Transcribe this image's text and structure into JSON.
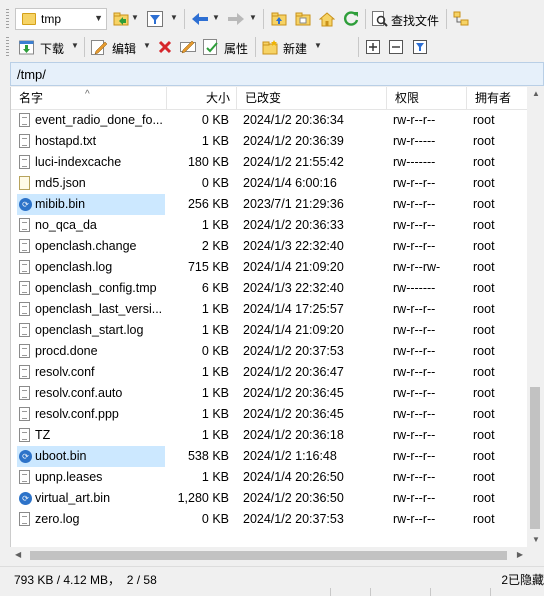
{
  "toolbar1": {
    "path_combo_value": "tmp",
    "find_files_label": "查找文件"
  },
  "toolbar2": {
    "download_label": "下载",
    "edit_label": "编辑",
    "properties_label": "属性",
    "new_label": "新建"
  },
  "path": "/tmp/",
  "columns": {
    "name": "名字",
    "size": "大小",
    "modified": "已改变",
    "permissions": "权限",
    "owner": "拥有者"
  },
  "files": [
    {
      "name": "event_radio_done_fo...",
      "size": "0 KB",
      "modified": "2024/1/2 20:36:34",
      "perm": "rw-r--r--",
      "owner": "root",
      "icon": "doc",
      "selected": false
    },
    {
      "name": "hostapd.txt",
      "size": "1 KB",
      "modified": "2024/1/2 20:36:39",
      "perm": "rw-r-----",
      "owner": "root",
      "icon": "doc",
      "selected": false
    },
    {
      "name": "luci-indexcache",
      "size": "180 KB",
      "modified": "2024/1/2 21:55:42",
      "perm": "rw-------",
      "owner": "root",
      "icon": "doc",
      "selected": false
    },
    {
      "name": "md5.json",
      "size": "0 KB",
      "modified": "2024/1/4 6:00:16",
      "perm": "rw-r--r--",
      "owner": "root",
      "icon": "json",
      "selected": false
    },
    {
      "name": "mibib.bin",
      "size": "256 KB",
      "modified": "2023/7/1 21:29:36",
      "perm": "rw-r--r--",
      "owner": "root",
      "icon": "bin",
      "selected": true
    },
    {
      "name": "no_qca_da",
      "size": "1 KB",
      "modified": "2024/1/2 20:36:33",
      "perm": "rw-r--r--",
      "owner": "root",
      "icon": "doc",
      "selected": false
    },
    {
      "name": "openclash.change",
      "size": "2 KB",
      "modified": "2024/1/3 22:32:40",
      "perm": "rw-r--r--",
      "owner": "root",
      "icon": "doc",
      "selected": false
    },
    {
      "name": "openclash.log",
      "size": "715 KB",
      "modified": "2024/1/4 21:09:20",
      "perm": "rw-r--rw-",
      "owner": "root",
      "icon": "doc",
      "selected": false
    },
    {
      "name": "openclash_config.tmp",
      "size": "6 KB",
      "modified": "2024/1/3 22:32:40",
      "perm": "rw-------",
      "owner": "root",
      "icon": "doc",
      "selected": false
    },
    {
      "name": "openclash_last_versi...",
      "size": "1 KB",
      "modified": "2024/1/4 17:25:57",
      "perm": "rw-r--r--",
      "owner": "root",
      "icon": "doc",
      "selected": false
    },
    {
      "name": "openclash_start.log",
      "size": "1 KB",
      "modified": "2024/1/4 21:09:20",
      "perm": "rw-r--r--",
      "owner": "root",
      "icon": "doc",
      "selected": false
    },
    {
      "name": "procd.done",
      "size": "0 KB",
      "modified": "2024/1/2 20:37:53",
      "perm": "rw-r--r--",
      "owner": "root",
      "icon": "doc",
      "selected": false
    },
    {
      "name": "resolv.conf",
      "size": "1 KB",
      "modified": "2024/1/2 20:36:47",
      "perm": "rw-r--r--",
      "owner": "root",
      "icon": "doc",
      "selected": false
    },
    {
      "name": "resolv.conf.auto",
      "size": "1 KB",
      "modified": "2024/1/2 20:36:45",
      "perm": "rw-r--r--",
      "owner": "root",
      "icon": "doc",
      "selected": false
    },
    {
      "name": "resolv.conf.ppp",
      "size": "1 KB",
      "modified": "2024/1/2 20:36:45",
      "perm": "rw-r--r--",
      "owner": "root",
      "icon": "doc",
      "selected": false
    },
    {
      "name": "TZ",
      "size": "1 KB",
      "modified": "2024/1/2 20:36:18",
      "perm": "rw-r--r--",
      "owner": "root",
      "icon": "doc",
      "selected": false
    },
    {
      "name": "uboot.bin",
      "size": "538 KB",
      "modified": "2024/1/2 1:16:48",
      "perm": "rw-r--r--",
      "owner": "root",
      "icon": "bin",
      "selected": true
    },
    {
      "name": "upnp.leases",
      "size": "1 KB",
      "modified": "2024/1/4 20:26:50",
      "perm": "rw-r--r--",
      "owner": "root",
      "icon": "doc",
      "selected": false
    },
    {
      "name": "virtual_art.bin",
      "size": "1,280 KB",
      "modified": "2024/1/2 20:36:50",
      "perm": "rw-r--r--",
      "owner": "root",
      "icon": "bin",
      "selected": false
    },
    {
      "name": "zero.log",
      "size": "0 KB",
      "modified": "2024/1/2 20:37:53",
      "perm": "rw-r--r--",
      "owner": "root",
      "icon": "doc",
      "selected": false
    }
  ],
  "status": {
    "left": "793 KB / 4.12 MB，  2 / 58",
    "right": "2已隐藏"
  },
  "colors": {
    "selection": "#cce8ff",
    "path_bar": "#e6f0fa",
    "green_refresh": "#2e9e3a",
    "blue_arrow": "#2d6fd3",
    "delete_red": "#d6262b"
  }
}
